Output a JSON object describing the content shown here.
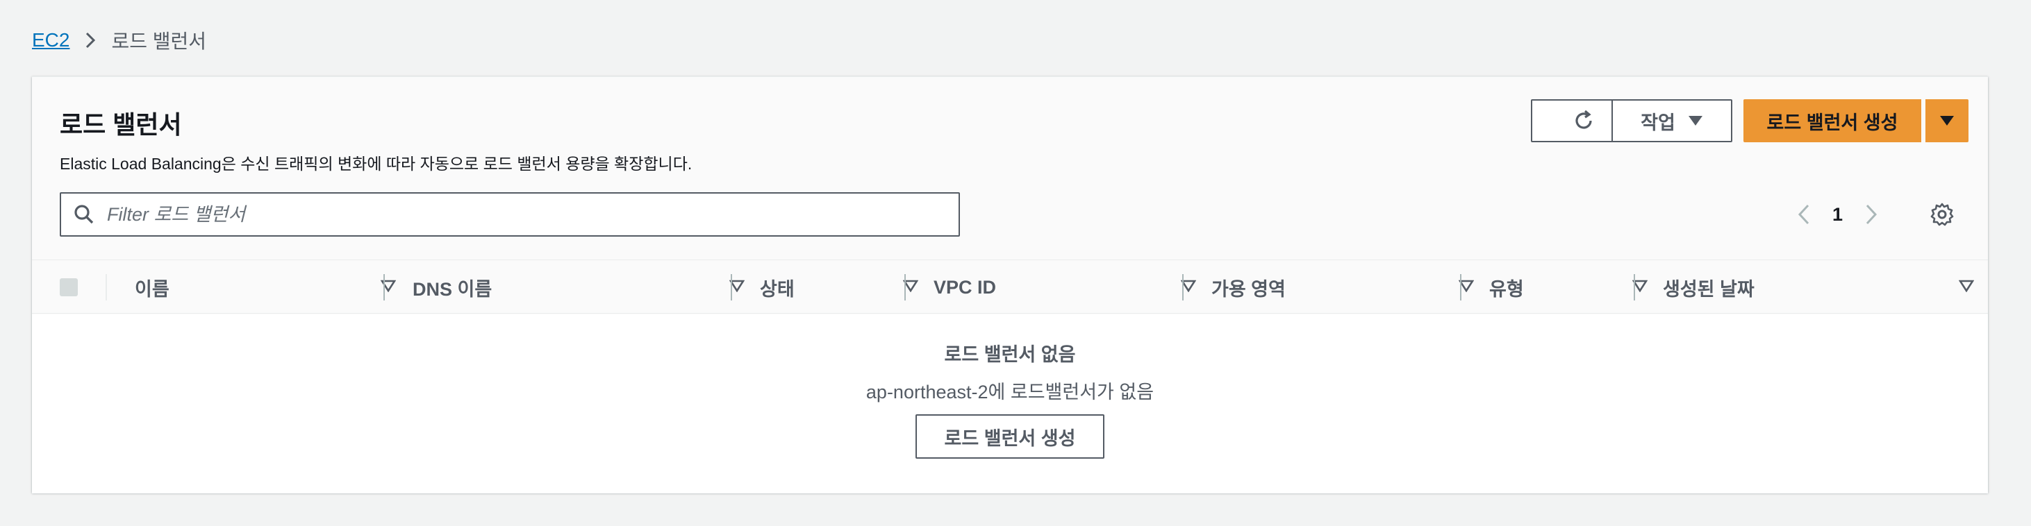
{
  "breadcrumb": {
    "root": "EC2",
    "current": "로드 밸런서"
  },
  "panel": {
    "title": "로드 밸런서",
    "description": "Elastic Load Balancing은 수신 트래픽의 변화에 따라 자동으로 로드 밸런서 용량을 확장합니다."
  },
  "toolbar": {
    "refresh_icon": "refresh-icon",
    "actions_label": "작업",
    "create_label": "로드 밸런서 생성"
  },
  "filter": {
    "placeholder": "Filter 로드 밸런서",
    "value": ""
  },
  "pagination": {
    "current_page": "1"
  },
  "table": {
    "columns": [
      "이름",
      "DNS 이름",
      "상태",
      "VPC ID",
      "가용 영역",
      "유형",
      "생성된 날짜"
    ]
  },
  "empty_state": {
    "title": "로드 밸런서 없음",
    "description": "ap-northeast-2에 로드밸런서가 없음",
    "button_label": "로드 밸런서 생성"
  },
  "colors": {
    "primary": "#ec9633",
    "link": "#0073bb",
    "border": "#545b64",
    "background": "#f2f3f3"
  }
}
